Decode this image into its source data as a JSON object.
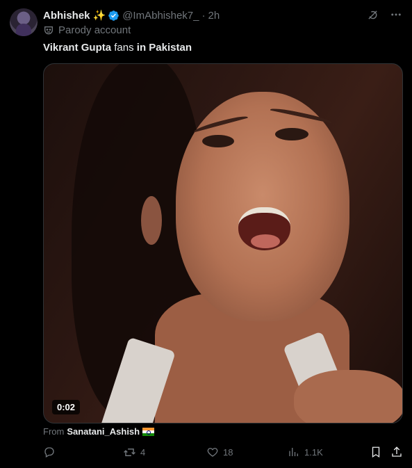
{
  "post": {
    "author_name": "Abhishek",
    "author_emoji": "✨",
    "handle": "@ImAbhishek7_",
    "separator": "·",
    "time": "2h",
    "parody_label": "Parody account",
    "text_part1": "Vikrant Gupta",
    "text_part2": " fans ",
    "text_part3": "in Pakistan",
    "video_duration": "0:02",
    "from_label": "From",
    "from_author": "Sanatani_Ashish"
  },
  "actions": {
    "reply_count": "",
    "retweet_count": "4",
    "like_count": "18",
    "views_count": "1.1K"
  },
  "icons": {
    "verified": "verified-badge-icon",
    "grok": "grok-icon",
    "more": "more-icon",
    "parody": "parody-mask-icon",
    "reply": "reply-icon",
    "retweet": "retweet-icon",
    "like": "like-icon",
    "views": "views-icon",
    "bookmark": "bookmark-icon",
    "share": "share-icon"
  },
  "colors": {
    "background": "#000000",
    "text": "#e7e9ea",
    "secondary": "#71767b",
    "verified": "#1d9bf0"
  }
}
